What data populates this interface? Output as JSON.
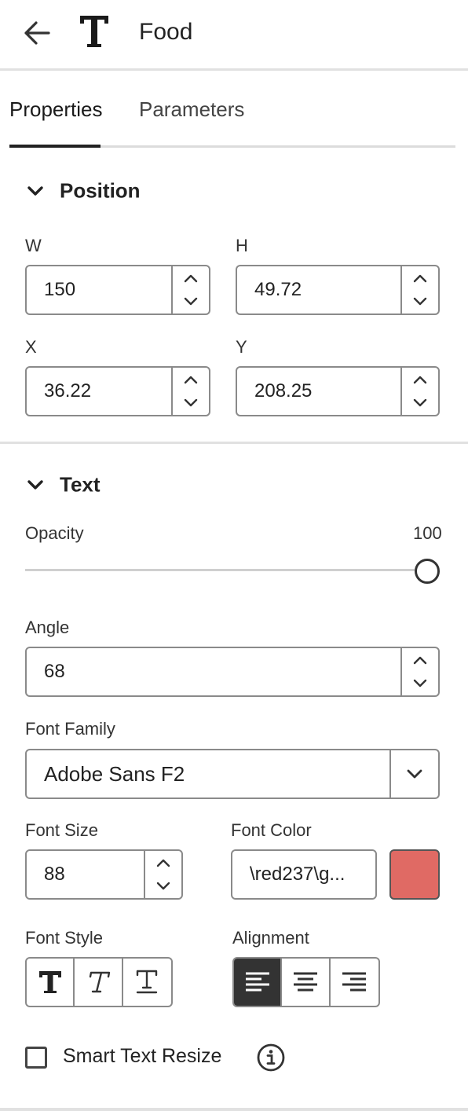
{
  "header": {
    "back_icon": "arrow-left-icon",
    "type_icon": "text-type-icon",
    "title": "Food"
  },
  "tabs": [
    {
      "label": "Properties",
      "active": true
    },
    {
      "label": "Parameters",
      "active": false
    }
  ],
  "position": {
    "heading": "Position",
    "w_label": "W",
    "w_value": "150",
    "h_label": "H",
    "h_value": "49.72",
    "x_label": "X",
    "x_value": "36.22",
    "y_label": "Y",
    "y_value": "208.25"
  },
  "text": {
    "heading": "Text",
    "opacity_label": "Opacity",
    "opacity_value": "100",
    "angle_label": "Angle",
    "angle_value": "68",
    "font_family_label": "Font Family",
    "font_family_value": "Adobe Sans F2",
    "font_size_label": "Font Size",
    "font_size_value": "88",
    "font_color_label": "Font Color",
    "font_color_value": "\\red237\\g...",
    "font_color_swatch": "#e06a64",
    "font_style_label": "Font Style",
    "alignment_label": "Alignment",
    "alignment_selected": "left",
    "smart_resize_label": "Smart Text Resize",
    "smart_resize_checked": false
  }
}
